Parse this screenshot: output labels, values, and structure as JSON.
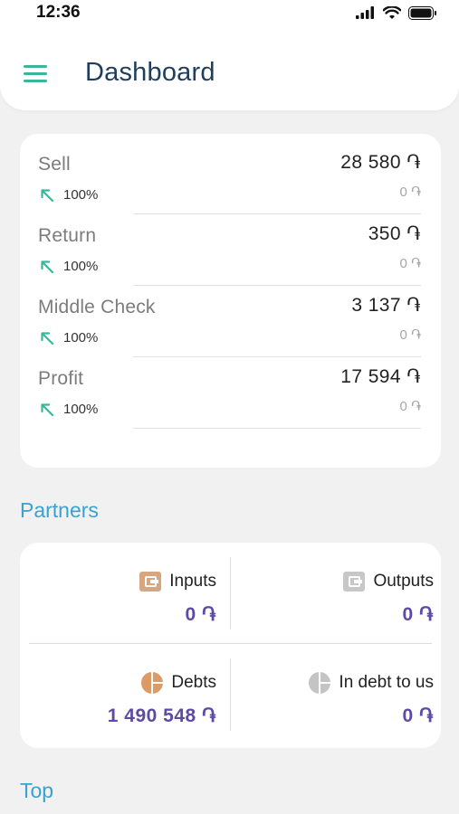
{
  "status_bar": {
    "time": "12:36"
  },
  "header": {
    "title": "Dashboard"
  },
  "stats": [
    {
      "label": "Sell",
      "value": "28 580 ֏",
      "percent": "100%",
      "prev": "0 ֏"
    },
    {
      "label": "Return",
      "value": "350 ֏",
      "percent": "100%",
      "prev": "0 ֏"
    },
    {
      "label": "Middle Check",
      "value": "3 137 ֏",
      "percent": "100%",
      "prev": "0 ֏"
    },
    {
      "label": "Profit",
      "value": "17 594 ֏",
      "percent": "100%",
      "prev": "0 ֏"
    }
  ],
  "partners": {
    "title": "Partners",
    "inputs": {
      "label": "Inputs",
      "value": "0 ֏"
    },
    "outputs": {
      "label": "Outputs",
      "value": "0 ֏"
    },
    "debts": {
      "label": "Debts",
      "value": "1 490 548 ֏"
    },
    "in_debt": {
      "label": "In debt to us",
      "value": "0 ֏"
    }
  },
  "top": {
    "title": "Top"
  },
  "colors": {
    "accent_green": "#37b89a",
    "title_navy": "#1f3e5d",
    "section_blue": "#3aa2d0",
    "value_purple": "#5d4ba3",
    "wallet_tan": "#d9a57c",
    "wallet_gray": "#c7c7c7",
    "pie_tan": "#dc9a66",
    "pie_gray": "#c4c4c4"
  },
  "icons": [
    "menu-icon",
    "trend-up-left-arrow-icon",
    "wallet-icon",
    "pie-chart-icon",
    "signal-icon",
    "wifi-icon",
    "battery-icon"
  ]
}
